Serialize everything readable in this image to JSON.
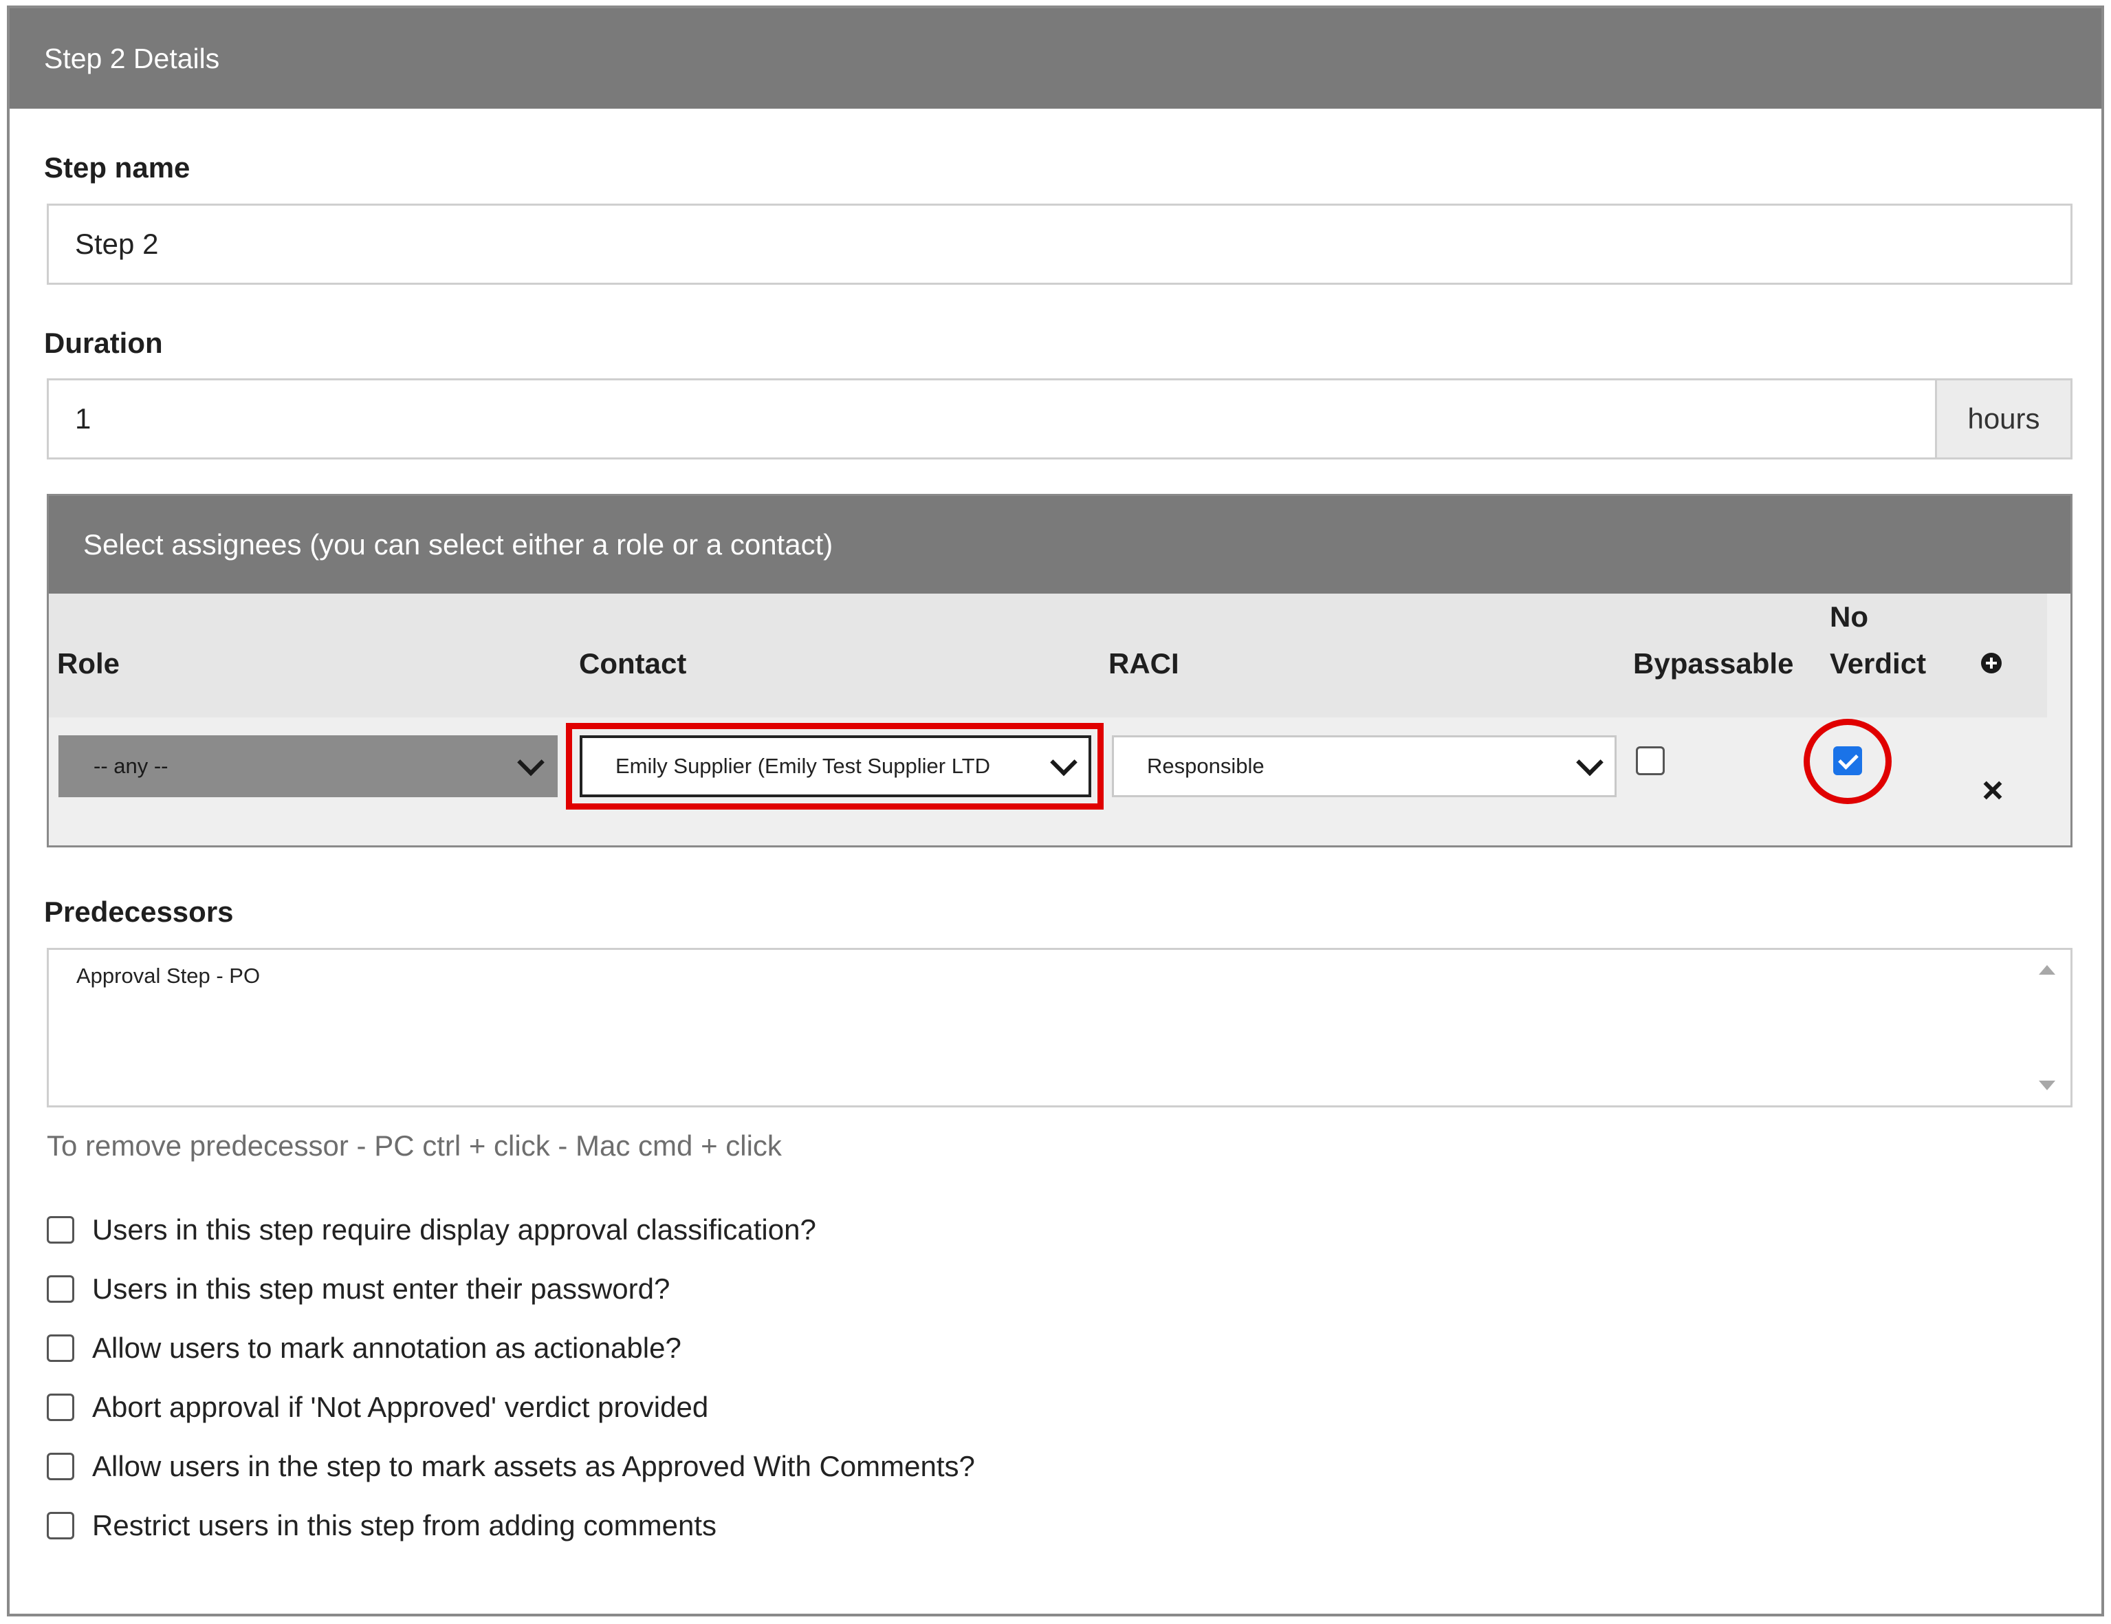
{
  "panel": {
    "title": "Step 2 Details"
  },
  "step_name": {
    "label": "Step name",
    "value": "Step 2"
  },
  "duration": {
    "label": "Duration",
    "value": "1",
    "unit": "hours"
  },
  "assignees": {
    "header": "Select assignees (you can select either a role or a contact)",
    "columns": {
      "role": "Role",
      "contact": "Contact",
      "raci": "RACI",
      "bypassable": "Bypassable",
      "no_verdict_line1": "No",
      "no_verdict_line2": "Verdict"
    },
    "row": {
      "role": "-- any --",
      "contact": "Emily Supplier (Emily Test Supplier LTD",
      "raci": "Responsible",
      "bypassable": false,
      "no_verdict": true
    },
    "icons": {
      "add": "plus-circle-icon",
      "remove": "close-icon"
    }
  },
  "predecessors": {
    "label": "Predecessors",
    "options": [
      "Approval Step - PO"
    ],
    "helper": "To remove predecessor - PC ctrl + click - Mac cmd + click"
  },
  "options": [
    {
      "label": "Users in this step require display approval classification?",
      "checked": false
    },
    {
      "label": "Users in this step must enter their password?",
      "checked": false
    },
    {
      "label": "Allow users to mark annotation as actionable?",
      "checked": false
    },
    {
      "label": "Abort approval if 'Not Approved' verdict provided",
      "checked": false
    },
    {
      "label": "Allow users in the step to mark assets as Approved With Comments?",
      "checked": false
    },
    {
      "label": "Restrict users in this step from adding comments",
      "checked": false
    }
  ],
  "colors": {
    "header_bg": "#7a7a7a",
    "highlight": "#e00000",
    "checkbox_checked": "#1a73e8"
  }
}
